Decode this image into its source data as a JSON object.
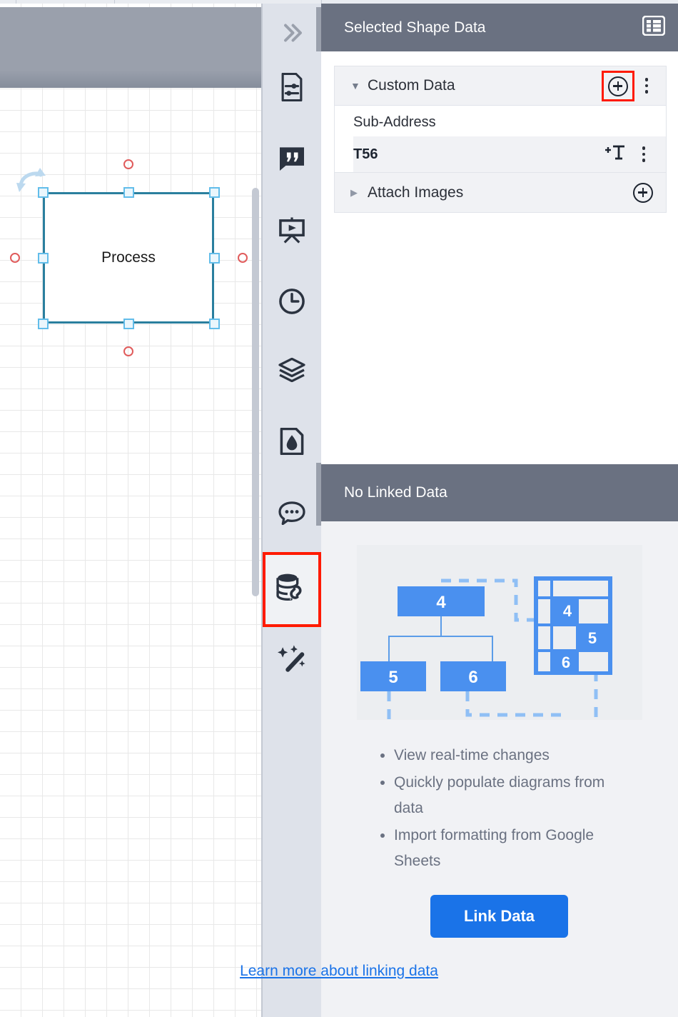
{
  "canvas": {
    "shape_label": "Process",
    "rotate_icon": "rotate-handle-icon"
  },
  "rail": {
    "items": [
      {
        "name": "collapse-panel",
        "icon": "double-chevron-right-icon"
      },
      {
        "name": "format-document",
        "icon": "document-settings-icon"
      },
      {
        "name": "notes",
        "icon": "quote-icon"
      },
      {
        "name": "present",
        "icon": "presentation-play-icon"
      },
      {
        "name": "version-history",
        "icon": "clock-icon"
      },
      {
        "name": "layers",
        "icon": "layers-icon"
      },
      {
        "name": "theme",
        "icon": "droplet-file-icon"
      },
      {
        "name": "comments",
        "icon": "comment-dots-icon"
      },
      {
        "name": "linked-data",
        "icon": "database-link-icon"
      },
      {
        "name": "ai-tools",
        "icon": "magic-wand-icon"
      }
    ],
    "active_index": 8
  },
  "panel": {
    "header": {
      "title": "Selected Shape Data",
      "table_icon": "table-list-icon"
    },
    "custom_data": {
      "label": "Custom Data",
      "caret": "▼",
      "add_icon": "plus-circle-icon",
      "menu_icon": "kebab-menu-icon",
      "fields": [
        {
          "key": "Sub-Address",
          "value": "T56",
          "text_icon": "add-text-icon",
          "menu_icon": "kebab-menu-icon"
        }
      ]
    },
    "attach_images": {
      "label": "Attach Images",
      "caret": "▶",
      "add_icon": "plus-circle-icon"
    }
  },
  "linked_data": {
    "header_title": "No Linked Data",
    "illustration": {
      "nodes": [
        "4",
        "5",
        "6"
      ],
      "sheet_cells": [
        "4",
        "5",
        "6"
      ]
    },
    "bullets": [
      "View real-time changes",
      "Quickly populate diagrams from data",
      "Import formatting from Google Sheets"
    ],
    "button_label": "Link Data",
    "learn_link": "Learn more about linking data"
  },
  "colors": {
    "accent_blue": "#1a73e8",
    "header_gray": "#6a7181",
    "rail_bg": "#dee2ea",
    "highlight_red": "#ff1a00",
    "shape_stroke": "#2a7f9e",
    "handle_blue": "#62bdea",
    "connector_red": "#e05b5b"
  }
}
